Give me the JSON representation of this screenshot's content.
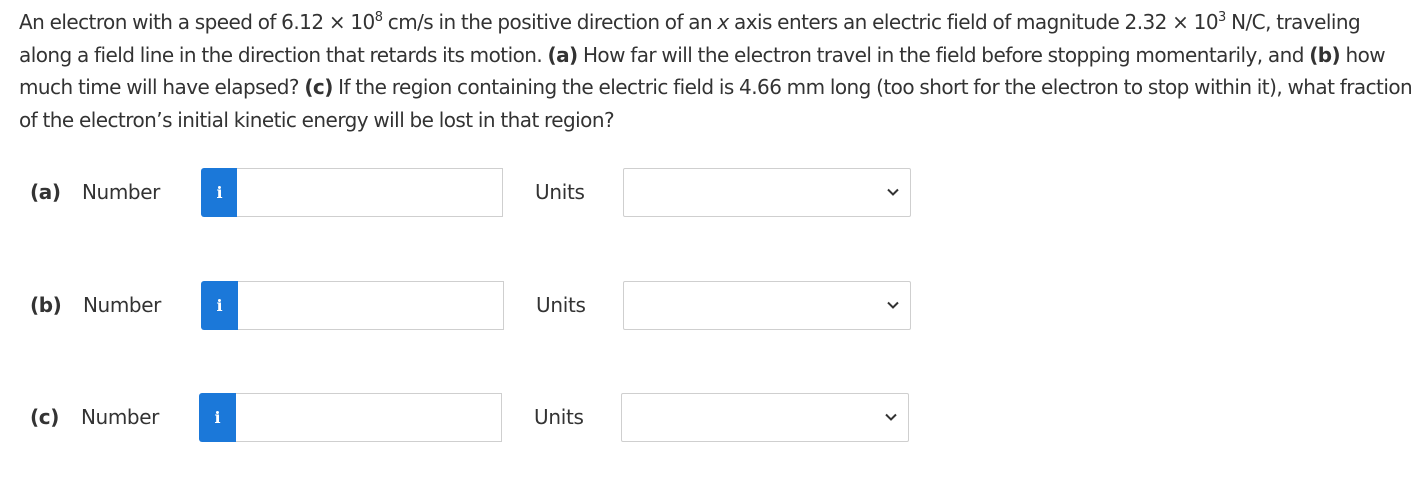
{
  "question": {
    "p1": "An electron with a speed of 6.12 × 10",
    "p1_exp": "8",
    "p2": " cm/s in the positive direction of an ",
    "p2_var": "x",
    "p3": " axis enters an electric field of magnitude 2.32 × 10",
    "p3_exp": "3",
    "p4": " N/C, traveling along a field line in the direction that retards its motion. ",
    "a_marker": "(a)",
    "a_text": " How far will the electron travel in the field before stopping momentarily, and ",
    "b_marker": "(b)",
    "b_text": " how much time will have elapsed? ",
    "c_marker": "(c)",
    "c_text": " If the region containing the electric field is 4.66 mm long (too short for the electron to stop within it), what fraction of the electron’s initial kinetic energy will be lost in that region?"
  },
  "answers": [
    {
      "part": "(a)",
      "number_label": "Number",
      "info_icon": "i",
      "value": "",
      "units_label": "Units",
      "units_selected": ""
    },
    {
      "part": "(b)",
      "number_label": "Number",
      "info_icon": "i",
      "value": "",
      "units_label": "Units",
      "units_selected": ""
    },
    {
      "part": "(c)",
      "number_label": "Number",
      "info_icon": "i",
      "value": "",
      "units_label": "Units",
      "units_selected": ""
    }
  ],
  "colors": {
    "text": "#333333",
    "info_button": "#1b78d9",
    "border": "#cfcfcf"
  },
  "icons": {
    "info": "info-icon",
    "dropdown": "chevron-down-icon"
  }
}
